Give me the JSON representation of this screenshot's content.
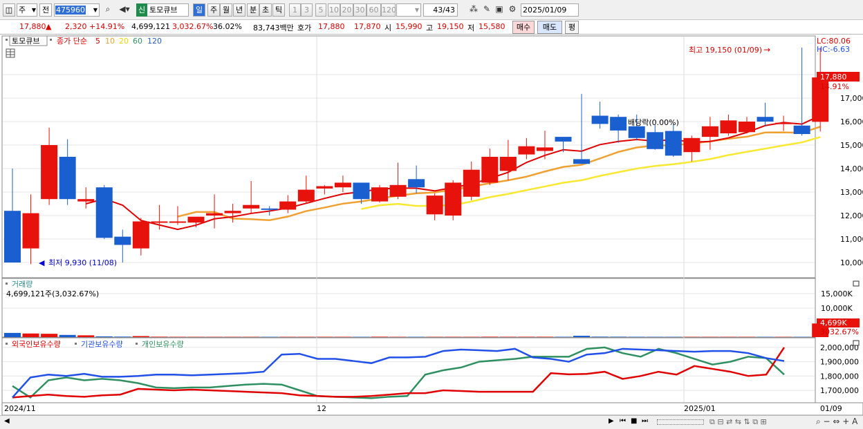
{
  "toolbar": {
    "market": "주",
    "prefix": "전",
    "code": "475960",
    "badge": "신",
    "name": "토모큐브",
    "periods": [
      "일",
      "주",
      "월",
      "년",
      "분",
      "초",
      "틱"
    ],
    "active_period": "일",
    "intervals": [
      "1",
      "3",
      "5",
      "10",
      "20",
      "30",
      "60",
      "120"
    ],
    "count": "43/43",
    "date": "2025/01/09"
  },
  "quote": {
    "price": "17,880",
    "change": "2,320 +14.91%",
    "volume": "4,699,121",
    "vol_ratio": "3,032.67%",
    "turnover": "36.02%",
    "amount": "83,743백만",
    "hoga_label": "호가",
    "ask": "17,880",
    "bid": "17,870",
    "open_label": "시",
    "open": "15,990",
    "high_label": "고",
    "high": "19,150",
    "low_label": "저",
    "low": "15,580",
    "buy": "매수",
    "sell": "매도",
    "eval": "평"
  },
  "price_panel": {
    "stock_tag": "토모큐브",
    "ma_label": "종가 단순",
    "ma_periods": [
      "5",
      "10",
      "20",
      "60",
      "120"
    ],
    "lc": "LC:80.06",
    "hc": "HC:-6.63",
    "max_label": "최고 19,150 (01/09)",
    "min_label": "최저 9,930 (11/08)",
    "dividend_label": "배당락(0.00%)",
    "price_tag": "17,880",
    "pct_tag": "14.91%"
  },
  "volume_panel": {
    "title": "거래량",
    "value_label": "4,699,121주(3,032.67%)",
    "vol_tag": "4,699K",
    "pct_tag": "3032.67%"
  },
  "holdings_panel": {
    "legends": [
      "외국인보유수량",
      "기관보유수량",
      "개인보유수량"
    ]
  },
  "x_axis": {
    "labels": [
      "2024/11",
      "12",
      "2025/01",
      "01/09"
    ]
  },
  "colors": {
    "up": "#e8120c",
    "down": "#1a5fd0",
    "ma5": "#e00000",
    "ma10": "#f0a030",
    "ma20": "#f8e830",
    "foreign": "#e00000",
    "inst": "#2050e8",
    "retail": "#2e9060"
  },
  "chart_data": {
    "type": "candlestick",
    "dates": [
      "11/05",
      "11/06",
      "11/07",
      "11/08",
      "11/11",
      "11/12",
      "11/13",
      "11/14",
      "11/15",
      "11/18",
      "11/19",
      "11/20",
      "11/21",
      "11/22",
      "11/25",
      "11/26",
      "11/27",
      "11/28",
      "11/29",
      "12/02",
      "12/03",
      "12/04",
      "12/05",
      "12/06",
      "12/09",
      "12/10",
      "12/11",
      "12/12",
      "12/13",
      "12/16",
      "12/17",
      "12/18",
      "12/19",
      "12/20",
      "12/23",
      "12/24",
      "12/26",
      "12/27",
      "12/30",
      "01/02",
      "01/03",
      "01/06",
      "01/07",
      "01/08",
      "01/09"
    ],
    "open": [
      12200,
      10600,
      12700,
      14500,
      12600,
      13200,
      11100,
      10600,
      11750,
      11750,
      11700,
      12000,
      12100,
      12300,
      12300,
      12250,
      12600,
      13150,
      13200,
      13400,
      12600,
      12800,
      13550,
      12050,
      12000,
      12800,
      13400,
      13900,
      14600,
      14750,
      15350,
      14400,
      16250,
      16200,
      15800,
      15550,
      15600,
      14700,
      15350,
      15500,
      15550,
      16200,
      15950,
      15830,
      15990
    ],
    "close": [
      10000,
      12100,
      15000,
      12700,
      12700,
      11050,
      10750,
      11750,
      11750,
      11750,
      11950,
      12100,
      12200,
      12450,
      12250,
      12600,
      13100,
      13250,
      13400,
      12700,
      13200,
      13300,
      13200,
      12850,
      13400,
      13950,
      14500,
      14500,
      14950,
      14900,
      15150,
      14200,
      15900,
      15620,
      15300,
      14830,
      14550,
      15300,
      15800,
      16050,
      16000,
      16000,
      15950,
      15470,
      17880
    ],
    "high": [
      14000,
      12900,
      15740,
      15250,
      13200,
      13300,
      11400,
      11900,
      12450,
      12400,
      11800,
      12900,
      12500,
      13470,
      12400,
      12870,
      13700,
      13300,
      13700,
      13150,
      13300,
      14250,
      14130,
      12950,
      13500,
      14300,
      14850,
      15220,
      15300,
      15610,
      15200,
      17180,
      16850,
      16300,
      16300,
      15850,
      15900,
      15400,
      16200,
      16300,
      16200,
      16800,
      16250,
      19150,
      19150
    ],
    "low": [
      10000,
      9930,
      12450,
      12450,
      12300,
      11000,
      10000,
      10300,
      11400,
      11600,
      11500,
      11450,
      11700,
      12100,
      12000,
      12100,
      12500,
      12900,
      13000,
      12500,
      12550,
      12700,
      12950,
      11800,
      11800,
      12650,
      13300,
      13500,
      14400,
      14400,
      14700,
      14200,
      15700,
      15100,
      15200,
      14800,
      14500,
      14300,
      14800,
      15400,
      15500,
      15800,
      15600,
      15400,
      15580
    ],
    "price_range": [
      9500,
      20000
    ],
    "price_ticks": [
      10000,
      11000,
      12000,
      13000,
      14000,
      15000,
      16000,
      17000,
      18000
    ],
    "volume": [
      1450000,
      1250000,
      1150000,
      760000,
      620000,
      250000,
      180000,
      360000,
      150000,
      120000,
      110000,
      100000,
      110000,
      110000,
      110000,
      110000,
      110000,
      125000,
      120000,
      110000,
      150000,
      105000,
      110000,
      105000,
      120000,
      110000,
      150000,
      130000,
      135000,
      140000,
      125000,
      470000,
      170000,
      150000,
      125000,
      110000,
      110000,
      105000,
      105000,
      110000,
      110000,
      105000,
      100000,
      100000,
      4699121
    ],
    "volume_ticks": [
      "10,000K",
      "15,000K"
    ],
    "holdings_ticks": [
      "1,700,000",
      "1,800,000",
      "1,900,000",
      "2,000,000"
    ],
    "holdings_range": [
      1650000,
      2030000
    ],
    "foreign": [
      1650000,
      1660000,
      1670000,
      1660000,
      1655000,
      1665000,
      1670000,
      1710000,
      1705000,
      1700000,
      1705000,
      1700000,
      1695000,
      1690000,
      1685000,
      1680000,
      1665000,
      1660000,
      1655000,
      1655000,
      1660000,
      1670000,
      1680000,
      1680000,
      1700000,
      1695000,
      1690000,
      1690000,
      1690000,
      1690000,
      1820000,
      1812000,
      1815000,
      1830000,
      1780000,
      1800000,
      1830000,
      1810000,
      1870000,
      1850000,
      1830000,
      1800000,
      1810000,
      2000000
    ],
    "inst": [
      1650000,
      1790000,
      1810000,
      1800000,
      1815000,
      1795000,
      1795000,
      1800000,
      1810000,
      1810000,
      1805000,
      1810000,
      1815000,
      1820000,
      1830000,
      1950000,
      1955000,
      1920000,
      1920000,
      1905000,
      1890000,
      1930000,
      1930000,
      1935000,
      1975000,
      1985000,
      1980000,
      1975000,
      1990000,
      1930000,
      1920000,
      1900000,
      1950000,
      1960000,
      1990000,
      1985000,
      1980000,
      1975000,
      1970000,
      1975000,
      1975000,
      1960000,
      1925000,
      1905000
    ],
    "retail": [
      1730000,
      1650000,
      1770000,
      1790000,
      1770000,
      1780000,
      1770000,
      1750000,
      1720000,
      1715000,
      1720000,
      1720000,
      1730000,
      1740000,
      1745000,
      1740000,
      1700000,
      1660000,
      1655000,
      1650000,
      1645000,
      1655000,
      1660000,
      1810000,
      1840000,
      1860000,
      1900000,
      1910000,
      1920000,
      1935000,
      1935000,
      1935000,
      1990000,
      2000000,
      1960000,
      1935000,
      1990000,
      1960000,
      1920000,
      1880000,
      1900000,
      1935000,
      1925000,
      1810000
    ]
  }
}
